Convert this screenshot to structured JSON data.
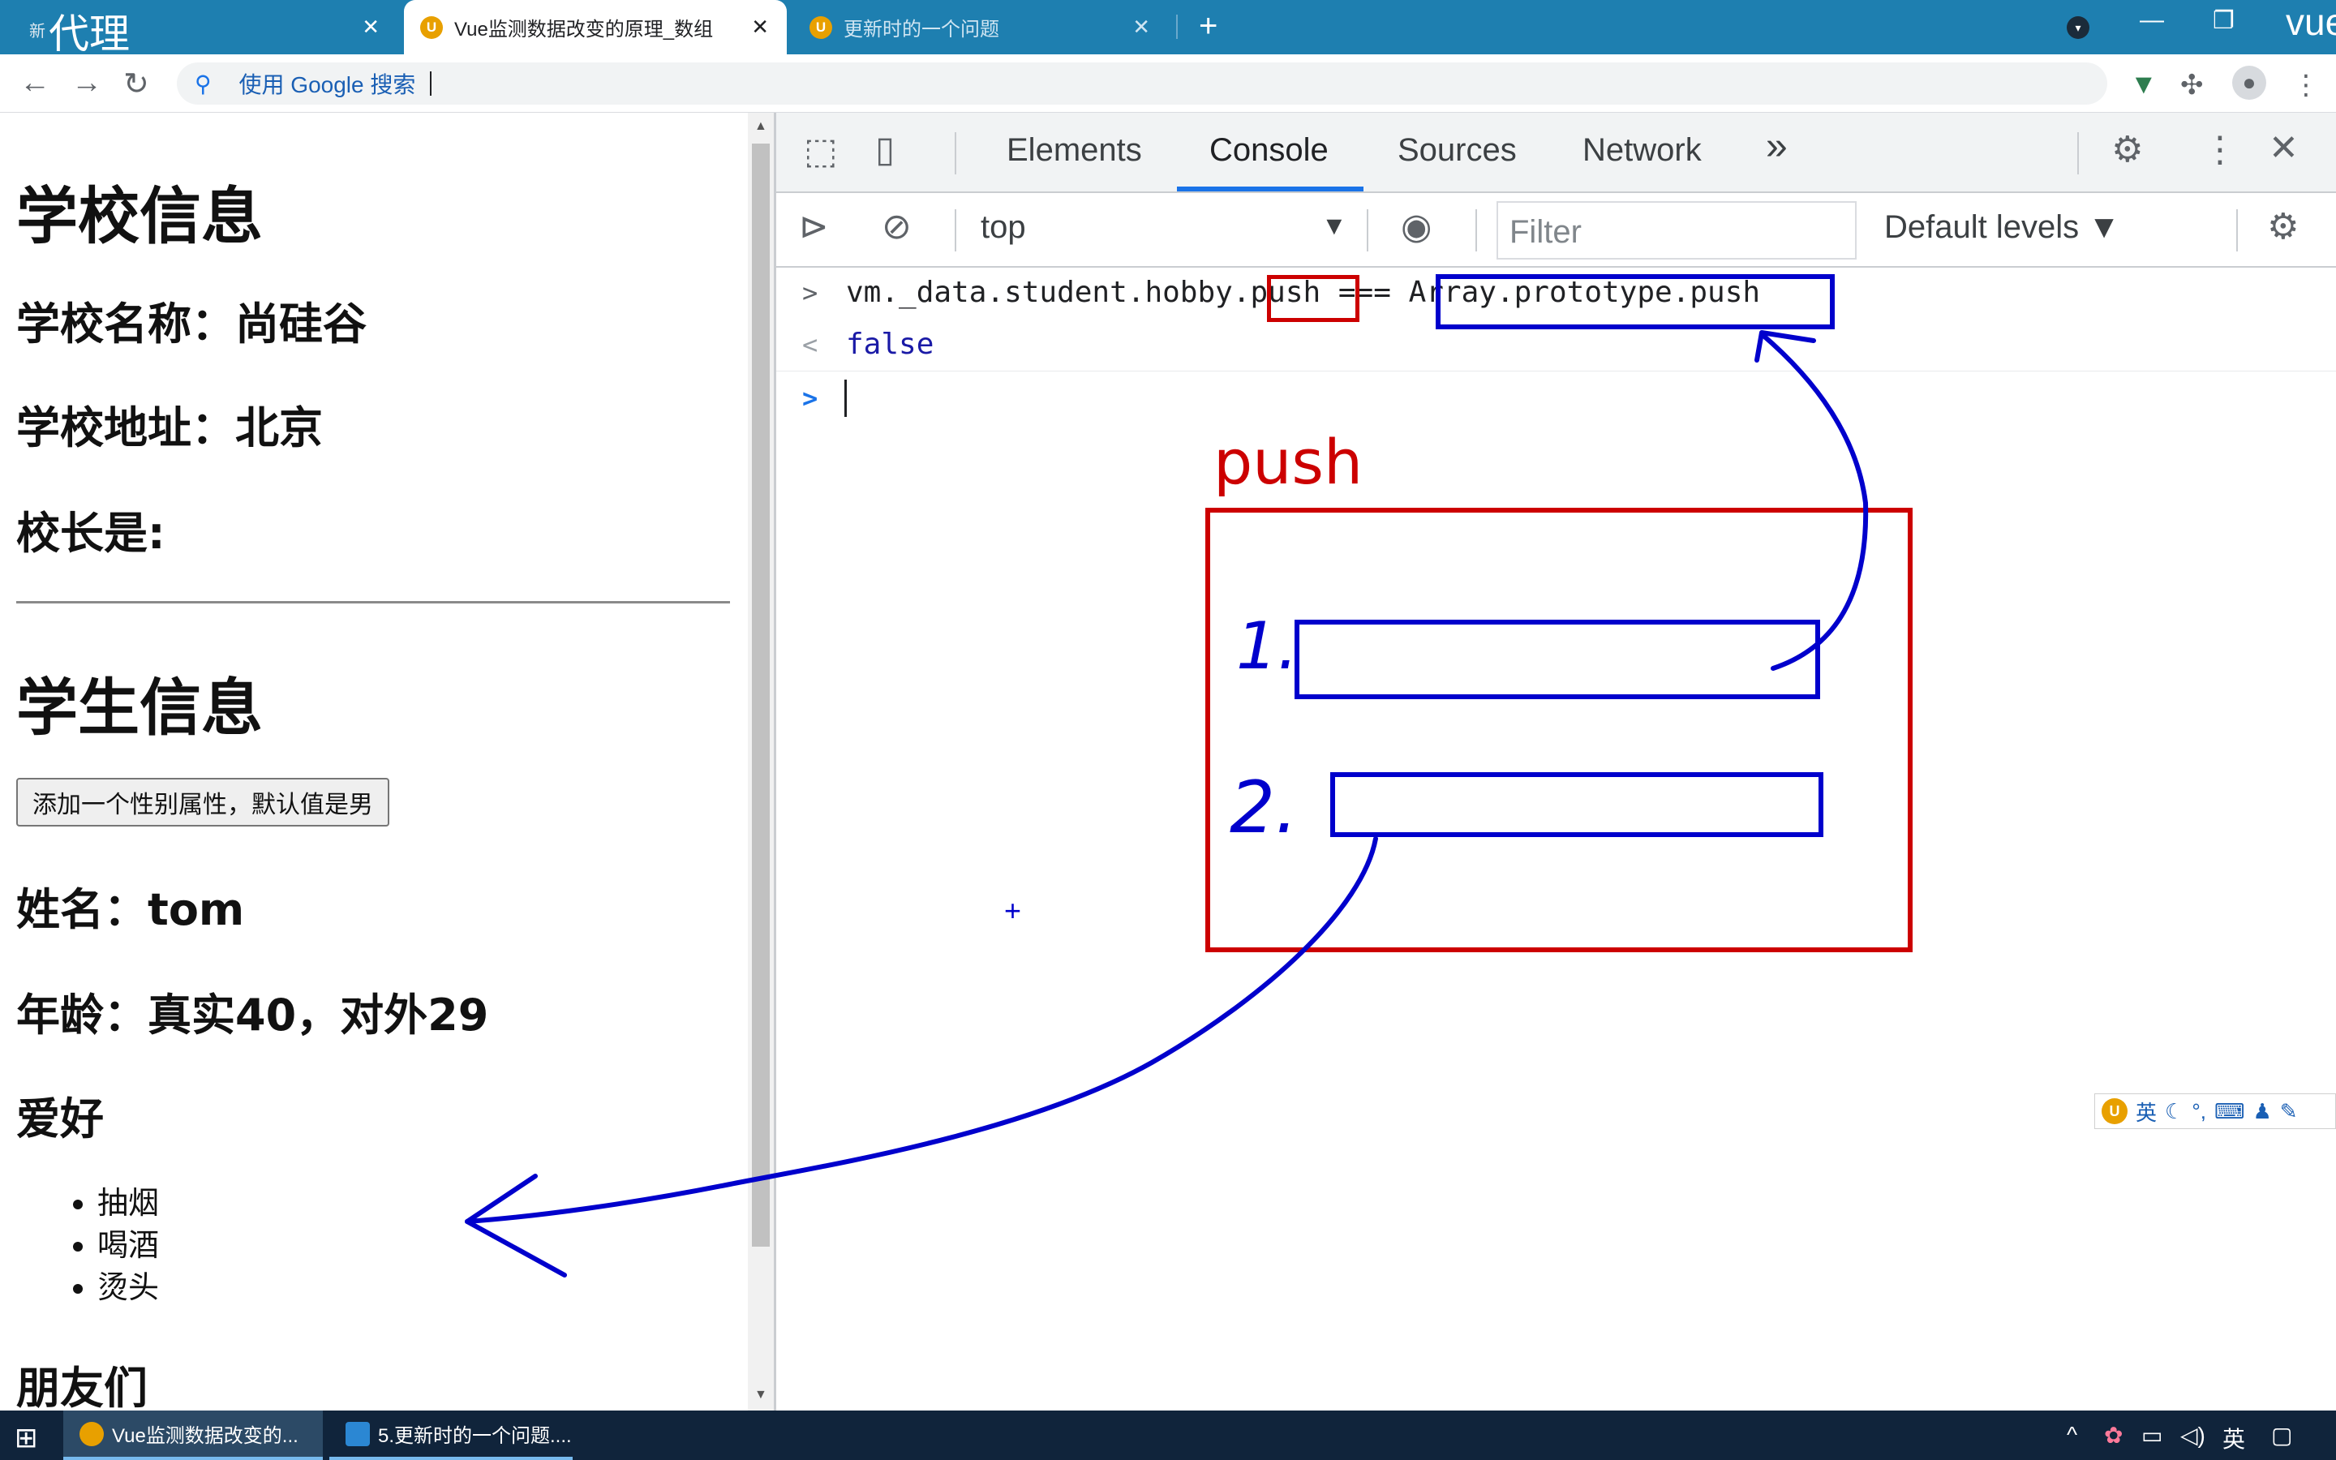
{
  "browser": {
    "tabs": [
      {
        "label": "新",
        "overlay_text": "代理",
        "close": "✕"
      },
      {
        "label": "Vue监测数据改变的原理_数组",
        "close": "✕"
      },
      {
        "label": "更新时的一个问题",
        "close": "✕"
      }
    ],
    "new_tab": "+",
    "overlay_text_right": "vue",
    "window_controls": {
      "minimize": "—",
      "restore": "❐"
    },
    "omnibox_placeholder": "使用 Google 搜索"
  },
  "page": {
    "school_heading": "学校信息",
    "school_name": "学校名称：尚硅谷",
    "school_address": "学校地址：北京",
    "principal": "校长是:",
    "student_heading": "学生信息",
    "add_button": "添加一个性别属性，默认值是男",
    "name": "姓名：tom",
    "age": "年龄：真实40，对外29",
    "hobby_heading": "爱好",
    "hobbies": [
      "抽烟",
      "喝酒",
      "烫头"
    ],
    "friends_heading": "朋友们"
  },
  "devtools": {
    "tabs": [
      "Elements",
      "Console",
      "Sources",
      "Network"
    ],
    "more_tabs": "»",
    "context": "top",
    "filter_placeholder": "Filter",
    "levels": "Default levels ▼",
    "console": {
      "input_prefix": "vm._data.student.hobby.",
      "input_push": "push",
      "input_op": " === ",
      "input_rhs": "Array.prototype.push",
      "result": "false",
      "input_marker": ">",
      "result_marker": "<"
    }
  },
  "annotation": {
    "label": "push",
    "item1": "1.",
    "item2": "2.",
    "crosshair": "+",
    "colors": {
      "red": "#cc0000",
      "blue": "#0000cc"
    }
  },
  "ime": {
    "lang": "英"
  },
  "taskbar": {
    "apps": [
      "Vue监测数据改变的...",
      "5.更新时的一个问题...."
    ],
    "lang": "英"
  }
}
